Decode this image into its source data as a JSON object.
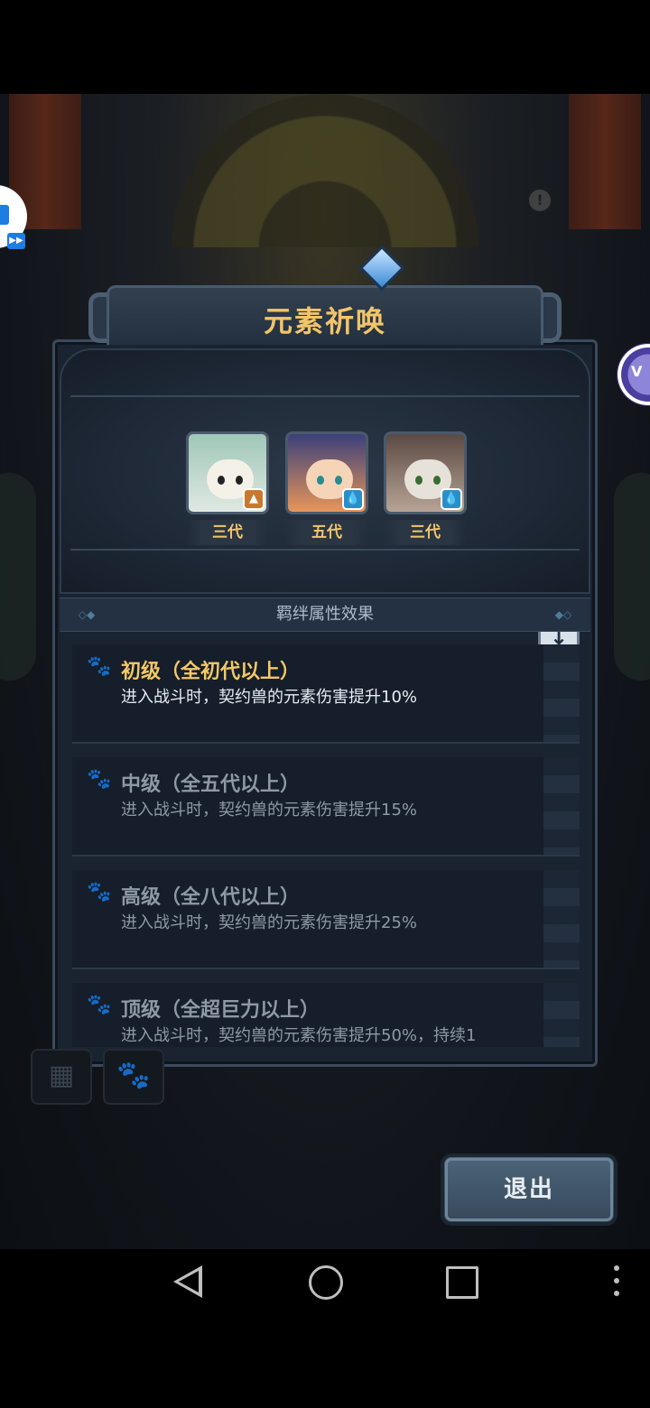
{
  "dialog": {
    "title": "元素祈唤",
    "bond_header": "羁绊属性效果",
    "exit_label": "退出"
  },
  "team": [
    {
      "generation": "三代",
      "element_icon": "earth-element-icon",
      "element_color": "#c9782d"
    },
    {
      "generation": "五代",
      "element_icon": "water-element-icon",
      "element_color": "#2a8fc8"
    },
    {
      "generation": "三代",
      "element_icon": "water-element-icon",
      "element_color": "#2a8fc8"
    }
  ],
  "bonds": [
    {
      "title": "初级（全初代以上）",
      "desc": "进入战斗时，契约兽的元素伤害提升10%",
      "active": true
    },
    {
      "title": "中级（全五代以上）",
      "desc": "进入战斗时，契约兽的元素伤害提升15%",
      "active": false
    },
    {
      "title": "高级（全八代以上）",
      "desc": "进入战斗时，契约兽的元素伤害提升25%",
      "active": false
    },
    {
      "title": "顶级（全超巨力以上）",
      "desc": "进入战斗时，契约兽的元素伤害提升50%，持续1",
      "active": false
    }
  ],
  "colors": {
    "accent_gold": "#f2c56a",
    "panel_bg": "#1a2330"
  }
}
